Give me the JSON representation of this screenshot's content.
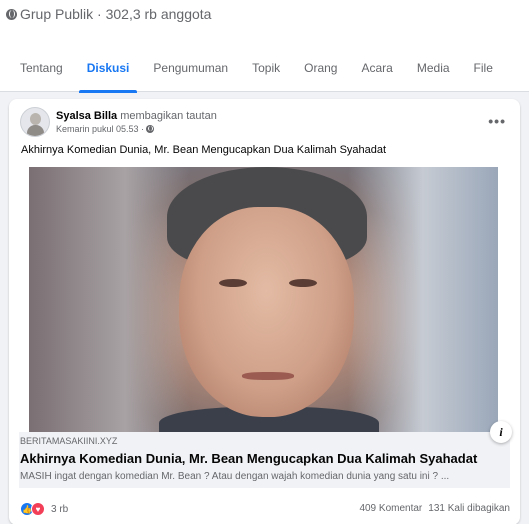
{
  "group": {
    "privacy_icon": "globe-icon",
    "meta": "Grup Publik · 302,3 rb anggota"
  },
  "tabs": [
    {
      "label": "Tentang",
      "active": false
    },
    {
      "label": "Diskusi",
      "active": true
    },
    {
      "label": "Pengumuman",
      "active": false
    },
    {
      "label": "Topik",
      "active": false
    },
    {
      "label": "Orang",
      "active": false
    },
    {
      "label": "Acara",
      "active": false
    },
    {
      "label": "Media",
      "active": false
    },
    {
      "label": "File",
      "active": false
    }
  ],
  "post": {
    "author": "Syalsa Billa",
    "action": "membagikan tautan",
    "time": "Kemarin pukul 05.53 ·",
    "more_icon": "•••",
    "text": "Akhirnya Komedian Dunia, Mr. Bean Mengucapkan Dua Kalimah Syahadat",
    "link": {
      "domain": "BERITAMASAKIINI.XYZ",
      "title": "Akhirnya Komedian Dunia, Mr. Bean Mengucapkan Dua Kalimah Syahadat",
      "description": "MASIH ingat dengan komedian Mr. Bean ? Atau dengan wajah komedian dunia yang satu ini ? ...",
      "info_icon": "i"
    },
    "reactions": {
      "count": "3 rb",
      "comments": "409 Komentar",
      "shares": "131 Kali dibagikan"
    }
  },
  "colors": {
    "accent": "#1877f2",
    "love": "#f33e58",
    "muted": "#65676b"
  }
}
